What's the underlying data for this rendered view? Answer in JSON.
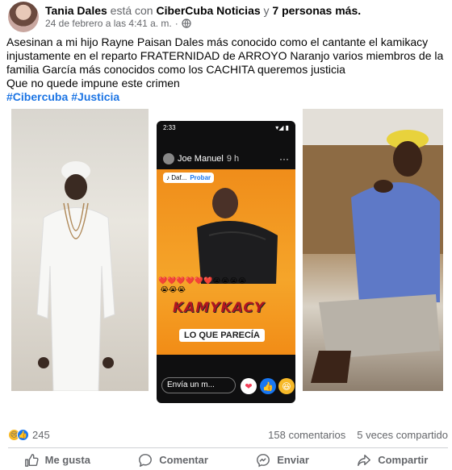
{
  "post": {
    "author": "Tania Dales",
    "connector1": "está con",
    "tagged_page": "CiberCuba Noticias",
    "connector2": "y",
    "others": "7 personas más.",
    "timestamp": "24 de febrero a las 4:41 a. m.",
    "separator": "·",
    "privacy_icon": "globe-icon",
    "text_lines": [
      "Asesinan a mi hijo Rayne Paisan Dales más conocido como el cantante el kamikacy injustamente en el reparto FRATERNIDAD de  ARROYO Naranjo varios miembros de la familia García más conocidos como los CACHITA queremos justicia",
      "Que no quede impune este crimen"
    ],
    "hashtags": [
      "#Cibercuba",
      "#Justicia"
    ]
  },
  "story_screenshot": {
    "status_time": "2:33",
    "status_right": "▾◢ ▮",
    "user": "Joe Manuel",
    "time": "9 h",
    "menu": "···",
    "music_label": "♪ Daf...",
    "music_action": "Probar",
    "hearts": "❤️❤️❤️❤️❤️❤️😭😭😭😭\n 😭😭😭",
    "banner": "KAMYKACY",
    "caption": "LO QUE PARECÍA",
    "reply_placeholder": "Envía un m..."
  },
  "stats": {
    "reactions_count": "245",
    "comments": "158 comentarios",
    "shares": "5 veces compartido"
  },
  "actions": {
    "like": "Me gusta",
    "comment": "Comentar",
    "send": "Enviar",
    "share": "Compartir"
  },
  "colors": {
    "link": "#1b74e4",
    "muted": "#65676b",
    "story_orange": "#f08d1a",
    "banner_red": "#b01620"
  }
}
